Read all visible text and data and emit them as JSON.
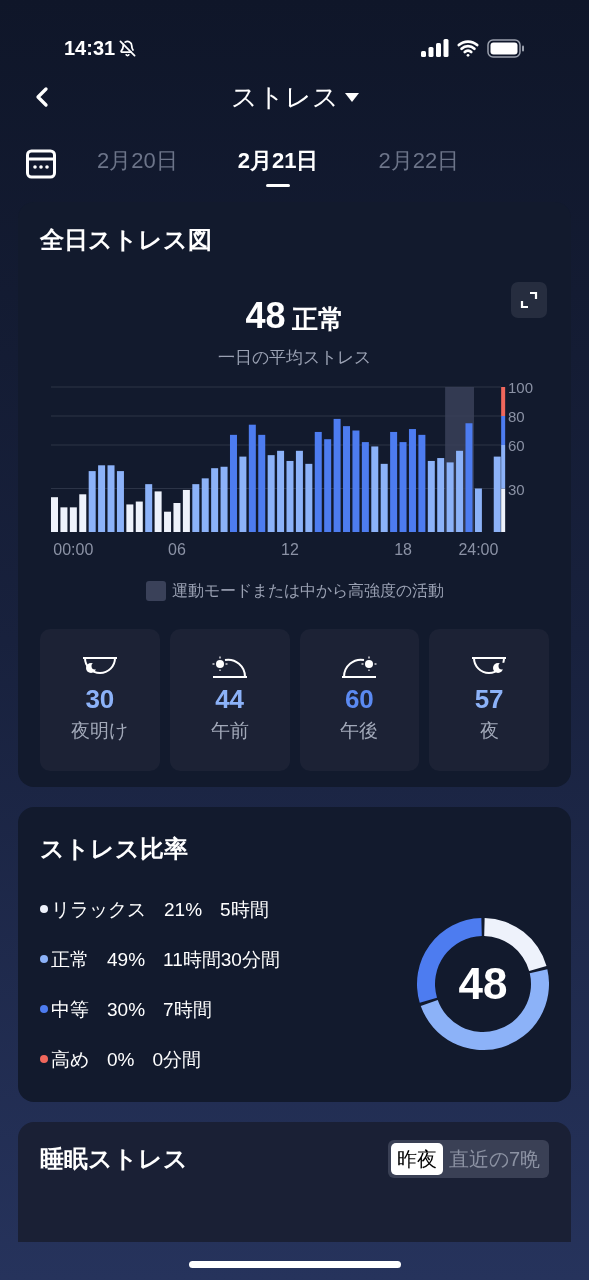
{
  "status_bar": {
    "time": "14:31"
  },
  "header": {
    "title": "ストレス"
  },
  "dates": [
    {
      "label": "2月20日",
      "selected": false
    },
    {
      "label": "2月21日",
      "selected": true
    },
    {
      "label": "2月22日",
      "selected": false
    }
  ],
  "daily_card": {
    "title": "全日ストレス図",
    "score": "48",
    "score_label": "正常",
    "subtitle": "一日の平均ストレス",
    "chart_data": {
      "type": "bar",
      "grid": true,
      "categories": [
        null,
        null,
        "00:00",
        null,
        null,
        null,
        null,
        null,
        null,
        null,
        null,
        null,
        null,
        "06",
        null,
        null,
        null,
        null,
        null,
        null,
        null,
        null,
        null,
        null,
        null,
        "12",
        null,
        null,
        null,
        null,
        null,
        null,
        null,
        null,
        null,
        null,
        null,
        "18",
        null,
        null,
        null,
        null,
        null,
        null,
        null,
        "24:00",
        null,
        null
      ],
      "ylim": [
        0,
        100
      ],
      "yticks": [
        30,
        60,
        80,
        100
      ],
      "series": [
        {
          "color": "#eef2fb",
          "values": [
            24,
            17,
            17,
            26,
            null,
            null,
            null,
            null,
            19,
            21,
            null,
            28,
            14,
            20,
            29,
            null,
            null,
            null,
            null,
            null,
            null,
            null,
            null,
            null,
            null,
            null,
            null,
            null,
            null,
            null,
            null,
            null,
            null,
            null,
            null,
            null,
            null,
            null,
            null,
            null,
            null,
            null,
            null,
            null,
            null,
            null,
            null,
            null
          ]
        },
        {
          "color": "#8cb2f8",
          "values": [
            null,
            null,
            null,
            null,
            42,
            46,
            46,
            42,
            null,
            null,
            33,
            null,
            null,
            null,
            null,
            33,
            37,
            44,
            45,
            null,
            52,
            null,
            null,
            53,
            56,
            49,
            56,
            47,
            null,
            null,
            null,
            null,
            null,
            null,
            59,
            47,
            null,
            null,
            null,
            null,
            49,
            51,
            48,
            56,
            null,
            30,
            null,
            52
          ]
        },
        {
          "color": "#4d7cf0",
          "values": [
            null,
            null,
            null,
            null,
            null,
            null,
            null,
            null,
            null,
            null,
            null,
            null,
            null,
            null,
            null,
            null,
            null,
            null,
            null,
            67,
            null,
            74,
            67,
            null,
            null,
            null,
            null,
            null,
            69,
            64,
            78,
            73,
            70,
            62,
            null,
            null,
            69,
            62,
            71,
            67,
            null,
            null,
            null,
            null,
            75,
            null,
            null,
            null
          ]
        }
      ]
    },
    "legend": {
      "label": "運動モードまたは中から高強度の活動",
      "color": "#3a4159"
    },
    "periods": [
      {
        "kind": "dawn",
        "value": "30",
        "label": "夜明け",
        "color": "#8cb2f8"
      },
      {
        "kind": "morning",
        "value": "44",
        "label": "午前",
        "color": "#8cb2f8"
      },
      {
        "kind": "afternoon",
        "value": "60",
        "label": "午後",
        "color": "#5b8af2"
      },
      {
        "kind": "night",
        "value": "57",
        "label": "夜",
        "color": "#8cb2f8"
      }
    ]
  },
  "ratio_card": {
    "title": "ストレス比率",
    "score": "48",
    "items": [
      {
        "name": "リラックス",
        "percent": "21%",
        "duration": "5時間",
        "color": "#eef2fb"
      },
      {
        "name": "正常",
        "percent": "49%",
        "duration": "11時間30分間",
        "color": "#8cb2f8"
      },
      {
        "name": "中等",
        "percent": "30%",
        "duration": "7時間",
        "color": "#4d7cf0"
      },
      {
        "name": "高め",
        "percent": "0%",
        "duration": "0分間",
        "color": "#f0675c"
      }
    ],
    "chart_data": {
      "type": "donut",
      "values": [
        21,
        49,
        30,
        0
      ]
    }
  },
  "sleep_card": {
    "title": "睡眠ストレス",
    "options": [
      {
        "label": "昨夜",
        "selected": true
      },
      {
        "label": "直近の7晩",
        "selected": false
      }
    ]
  }
}
